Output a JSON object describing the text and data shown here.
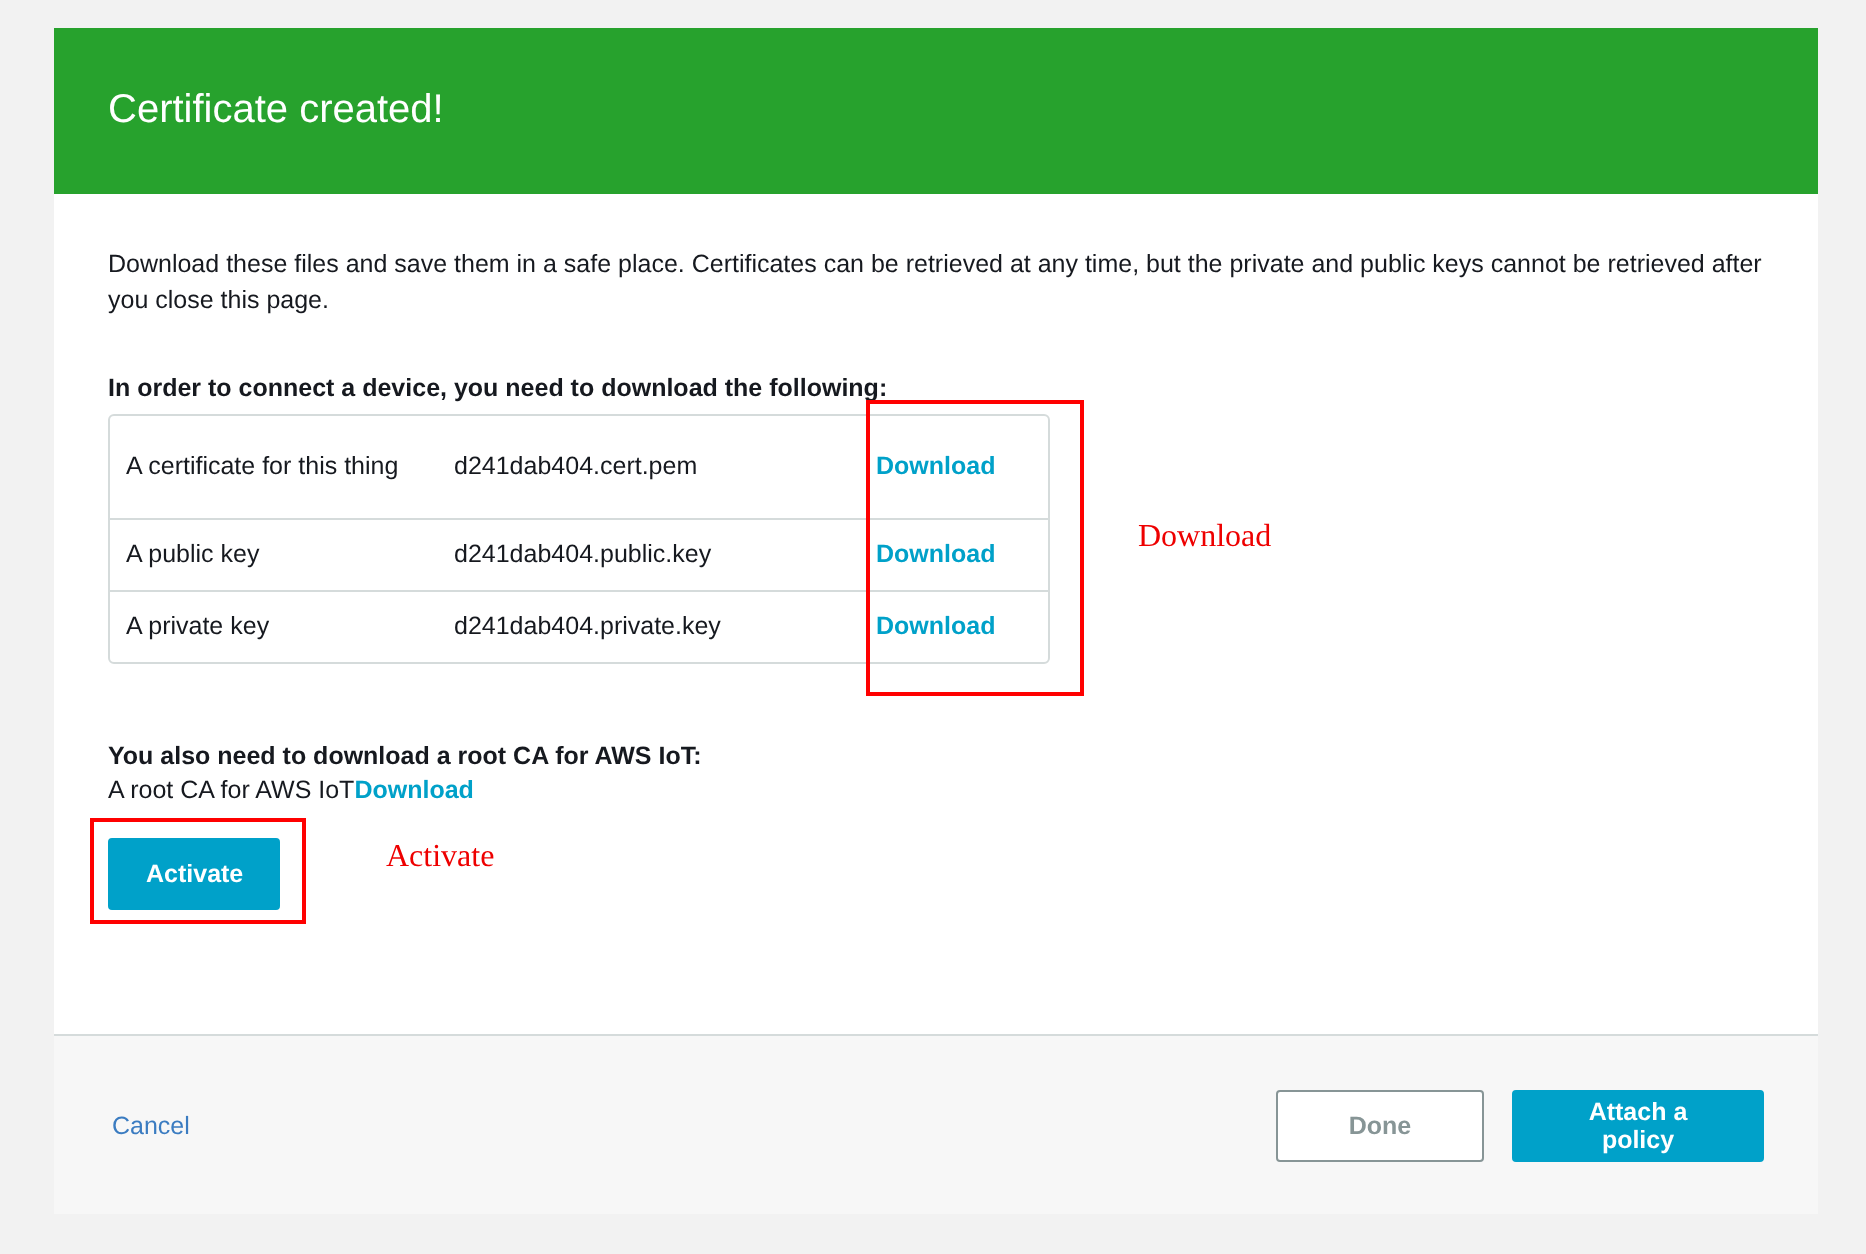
{
  "header": {
    "title": "Certificate created!"
  },
  "intro": "Download these files and save them in a safe place. Certificates can be retrieved at any time, but the private and public keys cannot be retrieved after you close this page.",
  "files_heading": "In order to connect a device, you need to download the following:",
  "files": [
    {
      "label": "A certificate for this thing",
      "file": "d241dab404.cert.pem",
      "link": "Download"
    },
    {
      "label": "A public key",
      "file": "d241dab404.public.key",
      "link": "Download"
    },
    {
      "label": "A private key",
      "file": "d241dab404.private.key",
      "link": "Download"
    }
  ],
  "root_ca": {
    "heading": "You also need to download a root CA for AWS IoT:",
    "label": "A root CA for AWS IoT",
    "link": "Download"
  },
  "activate_button": "Activate",
  "footer": {
    "cancel": "Cancel",
    "done": "Done",
    "attach": "Attach a policy"
  },
  "annotations": [
    {
      "kind": "downloads",
      "label": "Download"
    },
    {
      "kind": "activate",
      "label": "Activate"
    }
  ]
}
